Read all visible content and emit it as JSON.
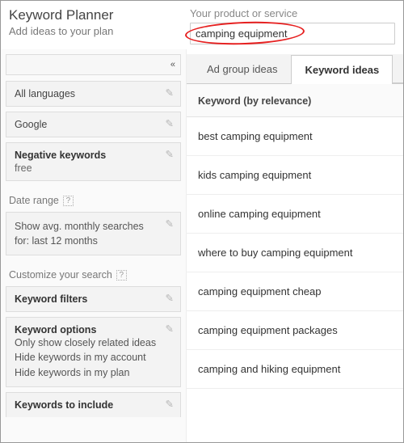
{
  "header": {
    "title": "Keyword Planner",
    "subtitle": "Add ideas to your plan",
    "product_label": "Your product or service",
    "product_value": "camping equipment"
  },
  "sidebar": {
    "collapse_glyph": "«",
    "languages": "All languages",
    "search_engine": "Google",
    "negative_title": "Negative keywords",
    "negative_value": "free",
    "date_section": "Date range",
    "date_text_l1": "Show avg. monthly searches",
    "date_text_l2": "for: last 12 months",
    "customize_section": "Customize your search",
    "filters_title": "Keyword filters",
    "options_title": "Keyword options",
    "options_l1": "Only show closely related ideas",
    "options_l2": "Hide keywords in my account",
    "options_l3": "Hide keywords in my plan",
    "include_title": "Keywords to include"
  },
  "tabs": {
    "adgroup": "Ad group ideas",
    "keyword": "Keyword ideas"
  },
  "table": {
    "header": "Keyword (by relevance)",
    "rows": [
      "best camping equipment",
      "kids camping equipment",
      "online camping equipment",
      "where to buy camping equipment",
      "camping equipment cheap",
      "camping equipment packages",
      "camping and hiking equipment"
    ]
  }
}
